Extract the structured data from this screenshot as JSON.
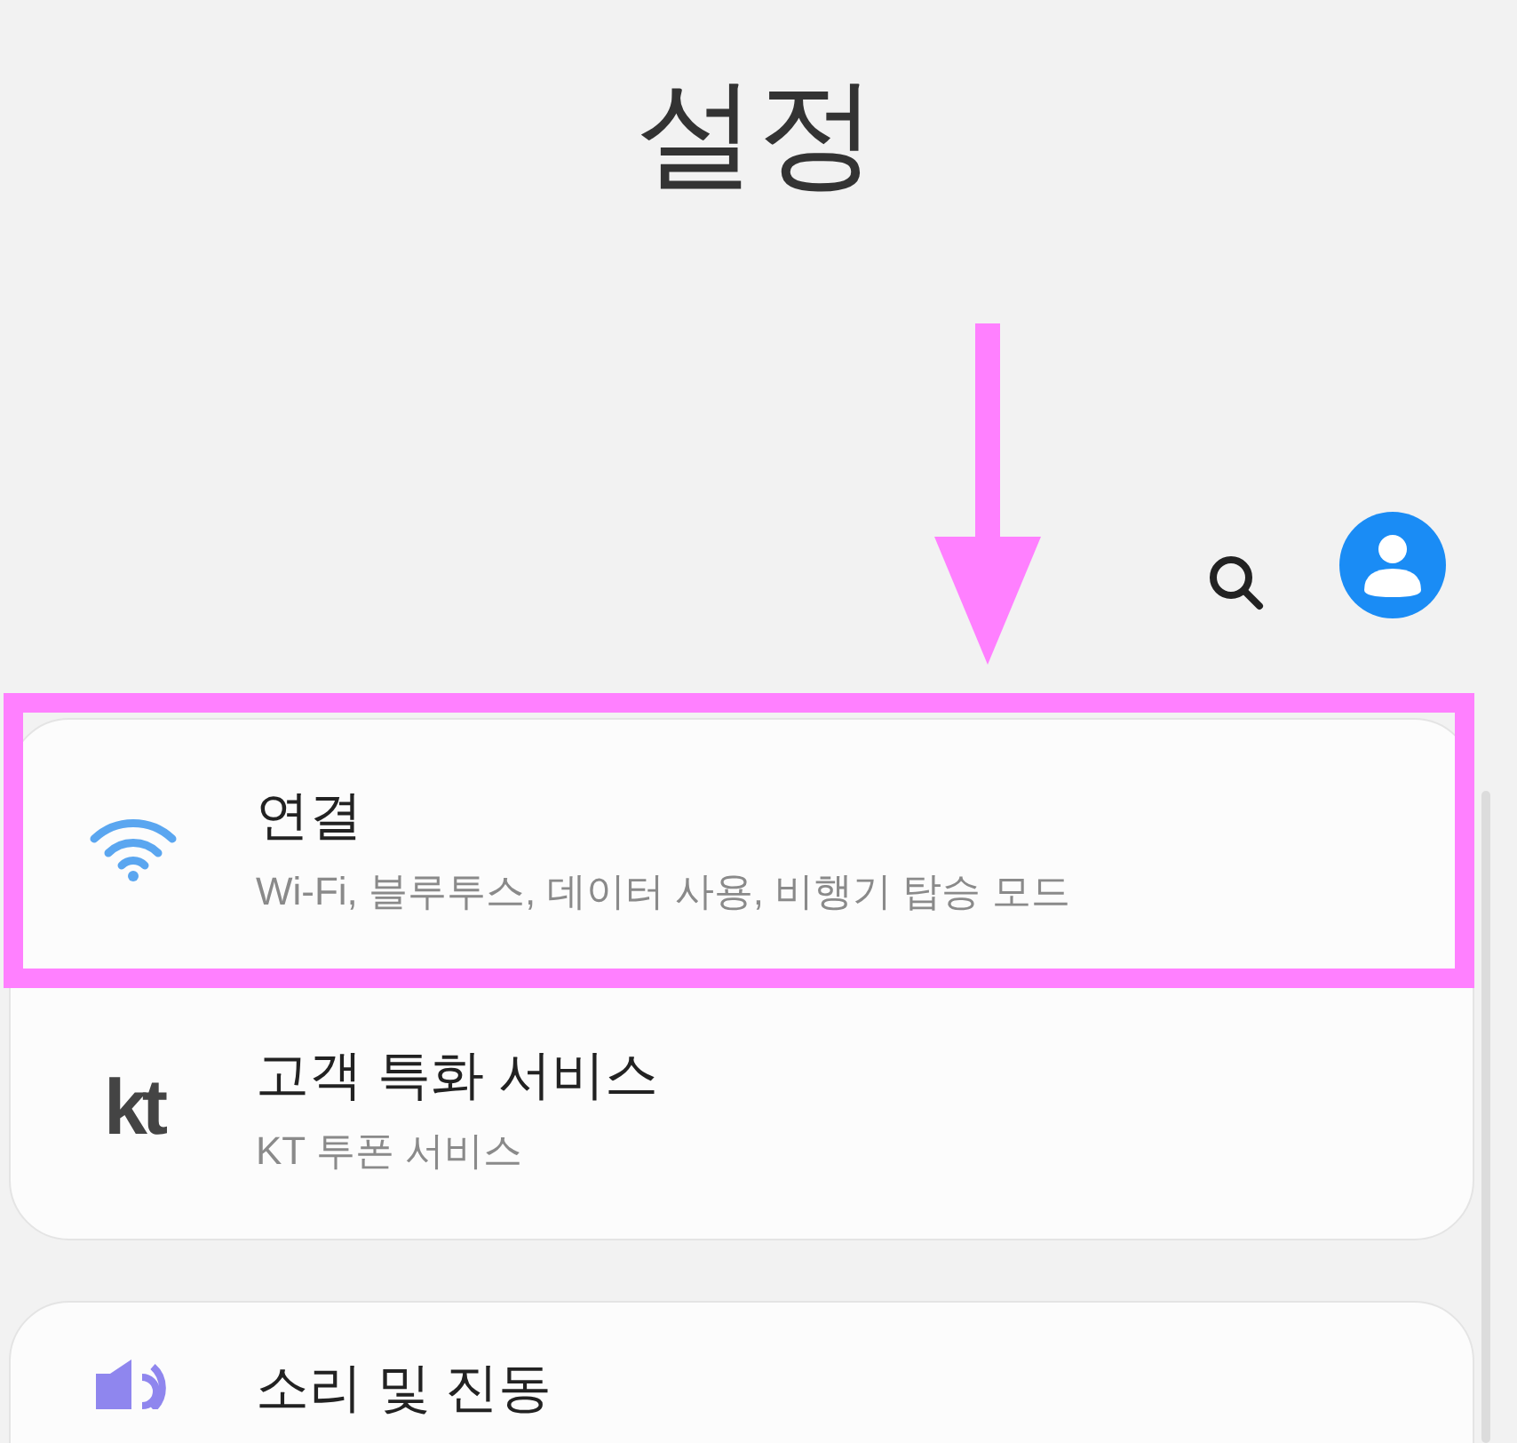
{
  "header": {
    "title": "설정"
  },
  "toolbar": {
    "buttons": [
      {
        "kind": "search"
      },
      {
        "kind": "account"
      }
    ]
  },
  "cards": [
    {
      "items": [
        {
          "kind": "wifi",
          "title": "연결",
          "subtitle": "Wi-Fi, 블루투스, 데이터 사용, 비행기 탑승 모드"
        },
        {
          "kind": "logo",
          "logo": "kt",
          "title": "고객 특화 서비스",
          "subtitle": "KT 투폰 서비스"
        }
      ]
    },
    {
      "items": [
        {
          "kind": "sound",
          "title": "소리 및 진동"
        }
      ]
    }
  ],
  "annotations": {
    "arrow": {
      "color": "#ff80ff"
    },
    "highlight_box": {
      "color": "#ff80ff"
    }
  }
}
